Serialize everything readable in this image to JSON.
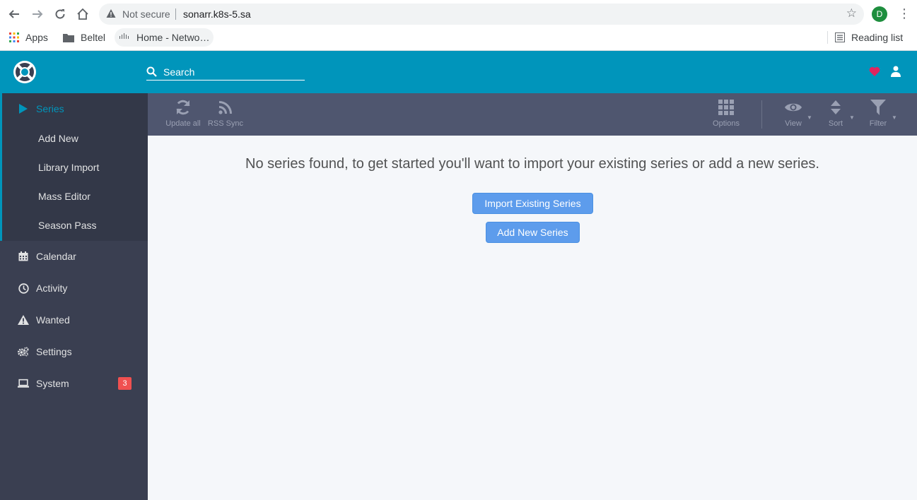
{
  "browser": {
    "security_label": "Not secure",
    "url": "sonarr.k8s-5.sa",
    "profile_initial": "D",
    "bookmarks": [
      "Apps",
      "Beltel",
      "Home - Netwo…"
    ],
    "reading_list": "Reading list"
  },
  "header": {
    "search_placeholder": "Search"
  },
  "sidebar": {
    "series": "Series",
    "sub_items": [
      "Add New",
      "Library Import",
      "Mass Editor",
      "Season Pass"
    ],
    "items": [
      "Calendar",
      "Activity",
      "Wanted",
      "Settings",
      "System"
    ],
    "system_badge": "3"
  },
  "toolbar": {
    "update_all": "Update all",
    "rss_sync": "RSS Sync",
    "options": "Options",
    "view": "View",
    "sort": "Sort",
    "filter": "Filter"
  },
  "main": {
    "empty_message": "No series found, to get started you'll want to import your existing series or add a new series.",
    "import_button": "Import Existing Series",
    "add_button": "Add New Series"
  },
  "colors": {
    "header": "#0095bb",
    "sidebar": "#3a3f51",
    "toolbar": "#4f566f",
    "primary_button": "#5d9cec",
    "badge": "#f05050"
  }
}
